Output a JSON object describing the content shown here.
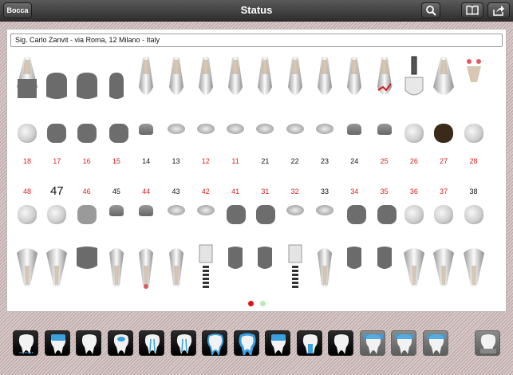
{
  "header": {
    "back_label": "Bocca",
    "title": "Status",
    "search_icon": "search-icon",
    "book_icon": "book-icon",
    "share_icon": "share-icon"
  },
  "patient": {
    "address": "Sig. Carlo Zanvit - via Roma, 12 Milano - Italy"
  },
  "upper_teeth": [
    {
      "number": "18",
      "color": "red",
      "status": "extracted-crown"
    },
    {
      "number": "17",
      "color": "red",
      "status": "grey"
    },
    {
      "number": "16",
      "color": "red",
      "status": "grey"
    },
    {
      "number": "15",
      "color": "red",
      "status": "grey"
    },
    {
      "number": "14",
      "color": "black",
      "status": "normal"
    },
    {
      "number": "13",
      "color": "black",
      "status": "normal"
    },
    {
      "number": "12",
      "color": "red",
      "status": "filling"
    },
    {
      "number": "11",
      "color": "red",
      "status": "filling"
    },
    {
      "number": "21",
      "color": "black",
      "status": "normal"
    },
    {
      "number": "22",
      "color": "black",
      "status": "normal"
    },
    {
      "number": "23",
      "color": "black",
      "status": "normal"
    },
    {
      "number": "24",
      "color": "black",
      "status": "normal"
    },
    {
      "number": "25",
      "color": "red",
      "status": "caries"
    },
    {
      "number": "26",
      "color": "red",
      "status": "implant"
    },
    {
      "number": "27",
      "color": "red",
      "status": "dark"
    },
    {
      "number": "28",
      "color": "red",
      "status": "roots"
    }
  ],
  "lower_teeth": [
    {
      "number": "48",
      "color": "red",
      "status": "normal"
    },
    {
      "number": "47",
      "color": "black",
      "status": "normal",
      "big": true
    },
    {
      "number": "46",
      "color": "red",
      "status": "missing"
    },
    {
      "number": "45",
      "color": "black",
      "status": "normal"
    },
    {
      "number": "44",
      "color": "red",
      "status": "endo"
    },
    {
      "number": "43",
      "color": "black",
      "status": "normal"
    },
    {
      "number": "42",
      "color": "red",
      "status": "implant"
    },
    {
      "number": "41",
      "color": "red",
      "status": "grey"
    },
    {
      "number": "31",
      "color": "red",
      "status": "grey"
    },
    {
      "number": "32",
      "color": "red",
      "status": "implant"
    },
    {
      "number": "33",
      "color": "black",
      "status": "normal"
    },
    {
      "number": "34",
      "color": "red",
      "status": "grey"
    },
    {
      "number": "35",
      "color": "red",
      "status": "grey"
    },
    {
      "number": "36",
      "color": "red",
      "status": "normal"
    },
    {
      "number": "37",
      "color": "red",
      "status": "normal"
    },
    {
      "number": "38",
      "color": "black",
      "status": "normal"
    }
  ],
  "page_indicator": {
    "pages": 2,
    "current": 1
  },
  "toolbar": [
    {
      "icon": "bleeding-icon"
    },
    {
      "icon": "crown-tooth-icon"
    },
    {
      "icon": "tooth-root-icon"
    },
    {
      "icon": "tooth-filling-icon"
    },
    {
      "icon": "tooth-endo-icon"
    },
    {
      "icon": "tooth-root-canal-icon"
    },
    {
      "icon": "tooth-glow-icon"
    },
    {
      "icon": "tooth-outline-icon"
    },
    {
      "icon": "tooth-cap-icon"
    },
    {
      "icon": "implant-crown-icon"
    },
    {
      "icon": "tooth-plain-icon"
    },
    {
      "icon": "bridge-piece-icon"
    },
    {
      "icon": "bridge-two-icon"
    },
    {
      "icon": "bridge-three-icon"
    },
    {
      "icon": "extraction-icon"
    }
  ],
  "colors": {
    "accent_red": "#e02020",
    "active_dot": "#e01414",
    "inactive_dot": "#b7ecb7"
  }
}
